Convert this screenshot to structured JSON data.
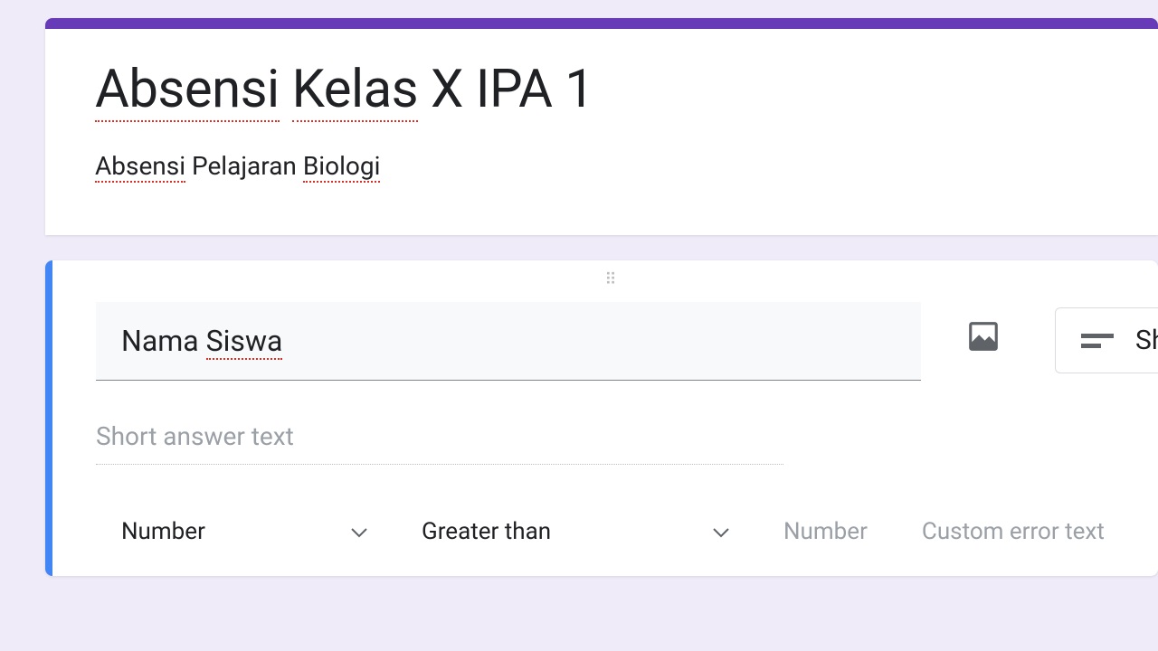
{
  "header": {
    "title_parts": {
      "w1": "Absensi",
      "w2": "Kelas",
      "rest": " X IPA 1"
    },
    "description_parts": {
      "w1": "Absensi",
      "mid": " Pelajaran ",
      "w2": "Biologi"
    }
  },
  "question": {
    "title_parts": {
      "pre": "Nama ",
      "w1": "Siswa"
    },
    "answer_preview": "Short answer text",
    "type_label": "Sh"
  },
  "validation": {
    "type": "Number",
    "condition": "Greater than",
    "value_placeholder": "Number",
    "error_placeholder": "Custom error text"
  }
}
